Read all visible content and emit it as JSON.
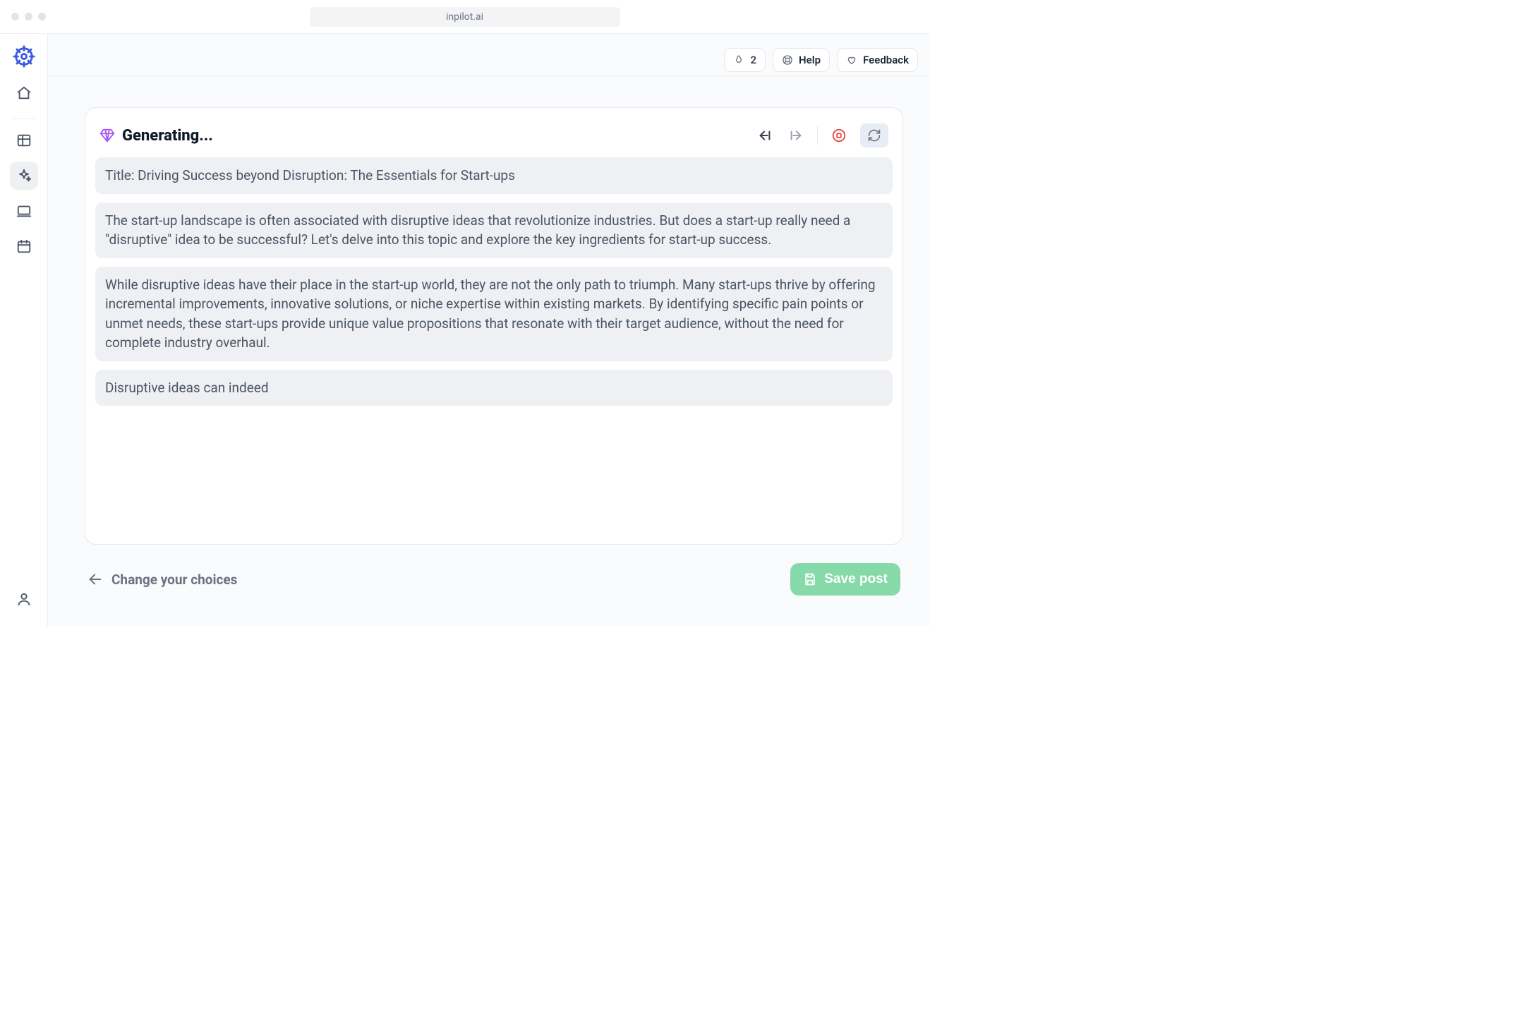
{
  "browser": {
    "url": "inpilot.ai"
  },
  "topbar": {
    "streak_count": "2",
    "help_label": "Help",
    "feedback_label": "Feedback"
  },
  "sidebar": {
    "icons": {
      "logo": "ship-wheel-icon",
      "home": "home-icon",
      "table": "table-icon",
      "sparkles": "sparkles-icon",
      "monitor": "monitor-icon",
      "calendar": "calendar-icon",
      "user": "user-icon"
    }
  },
  "card": {
    "status": "Generating..."
  },
  "blocks": [
    "Title: Driving Success beyond Disruption: The Essentials for Start-ups",
    "The start-up landscape is often associated with disruptive ideas that revolutionize industries. But does a start-up really need a \"disruptive\" idea to be successful? Let's delve into this topic and explore the key ingredients for start-up success.",
    "While disruptive ideas have their place in the start-up world, they are not the only path to triumph. Many start-ups thrive by offering incremental improvements, innovative solutions, or niche expertise within existing markets. By identifying specific pain points or unmet needs, these start-ups provide unique value propositions that resonate with their target audience, without the need for complete industry overhaul.",
    "Disruptive ideas can indeed"
  ],
  "footer": {
    "change_label": "Change your choices",
    "save_label": "Save post"
  }
}
